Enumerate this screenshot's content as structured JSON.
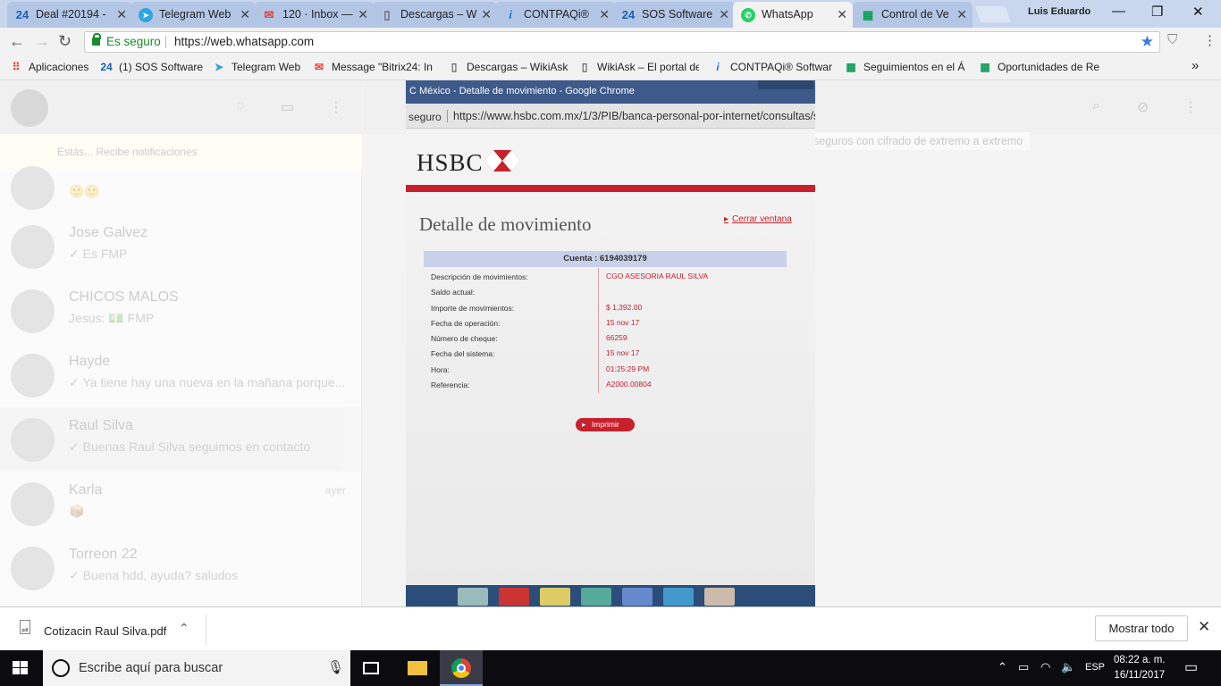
{
  "browser": {
    "tabs": [
      {
        "label": "Deal #20194 -",
        "icon": "24"
      },
      {
        "label": "Telegram Web",
        "icon": "telegram"
      },
      {
        "label": "120 · Inbox —",
        "icon": "mail"
      },
      {
        "label": "Descargas – W",
        "icon": "page"
      },
      {
        "label": "CONTPAQi®",
        "icon": "i"
      },
      {
        "label": "SOS Software",
        "icon": "24"
      },
      {
        "label": "WhatsApp",
        "icon": "whatsapp"
      },
      {
        "label": "Control de Ve",
        "icon": "sheet"
      }
    ],
    "profile_name": "Luis Eduardo",
    "secure_label": "Es seguro",
    "url": "https://web.whatsapp.com",
    "bookmarks": [
      {
        "label": "Aplicaciones",
        "icon": "apps"
      },
      {
        "label": "(1) SOS Software",
        "icon": "24"
      },
      {
        "label": "Telegram Web",
        "icon": "telegram"
      },
      {
        "label": "Message \"Bitrix24: In",
        "icon": "mail"
      },
      {
        "label": "Descargas – WikiAsk",
        "icon": "page"
      },
      {
        "label": "WikiAsk – El portal de",
        "icon": "page"
      },
      {
        "label": "CONTPAQi® Softwar",
        "icon": "i"
      },
      {
        "label": "Seguimientos en el Á",
        "icon": "sheet"
      },
      {
        "label": "Oportunidades de Re",
        "icon": "sheet"
      }
    ],
    "more_bookmarks": "»"
  },
  "whatsapp": {
    "notice": "Estás... Recibe notificaciones",
    "encryption_note": "seguros con cifrado de extremo a extremo",
    "chats": [
      {
        "name": "",
        "message": "🙂🙂",
        "time": ""
      },
      {
        "name": "Jose Galvez",
        "message": "✓ Es FMP",
        "time": ""
      },
      {
        "name": "CHICOS MALOS",
        "message": "Jesus: 💵 FMP",
        "time": ""
      },
      {
        "name": "Hayde",
        "message": "✓ Ya tiene hay una nueva en la mañana porque...",
        "time": ""
      },
      {
        "name": "Raul Silva",
        "message": "✓ Buenas Raul Silva seguimos en contacto",
        "time": ""
      },
      {
        "name": "Karla",
        "message": "📦",
        "time": "ayer"
      },
      {
        "name": "Torreon 22",
        "message": "✓ Buena hdd, ayuda? saludos",
        "time": ""
      }
    ]
  },
  "photo": {
    "window_title": "C México - Detalle de movimiento - Google Chrome",
    "secure": "seguro",
    "url": "https://www.hsbc.com.mx/1/3/PIB/banca-personal-por-internet/consultas/sa",
    "bank_logo": "HSBC",
    "heading": "Detalle de movimiento",
    "close_link": "Cerrar ventana",
    "account": "Cuenta : 6194039179",
    "fields": [
      {
        "label": "Descripción de movimientos:",
        "value": "CGO ASESORIA RAUL SILVA"
      },
      {
        "label": "Saldo actual:",
        "value": ""
      },
      {
        "label": "Importe de movimientos:",
        "value": "$ 1,392.00"
      },
      {
        "label": "Fecha de operación:",
        "value": "15 nov 17"
      },
      {
        "label": "Número de cheque:",
        "value": "66259"
      },
      {
        "label": "Fecha del sistema:",
        "value": "15 nov 17"
      },
      {
        "label": "Hora:",
        "value": "01:25:29 PM"
      },
      {
        "label": "Referencia:",
        "value": "A2000.00804"
      }
    ],
    "print_label": "Imprimir"
  },
  "download": {
    "file_name": "Cotizacin Raul Silva.pdf",
    "show_all": "Mostrar todo"
  },
  "taskbar": {
    "search_placeholder": "Escribe aquí para buscar",
    "language": "ESP",
    "time": "08:22 a. m.",
    "date": "16/11/2017"
  },
  "colors": {
    "hsbc_red": "#c8202c",
    "secure_green": "#1a8a2c",
    "tab_bar": "#c9d7ee"
  }
}
